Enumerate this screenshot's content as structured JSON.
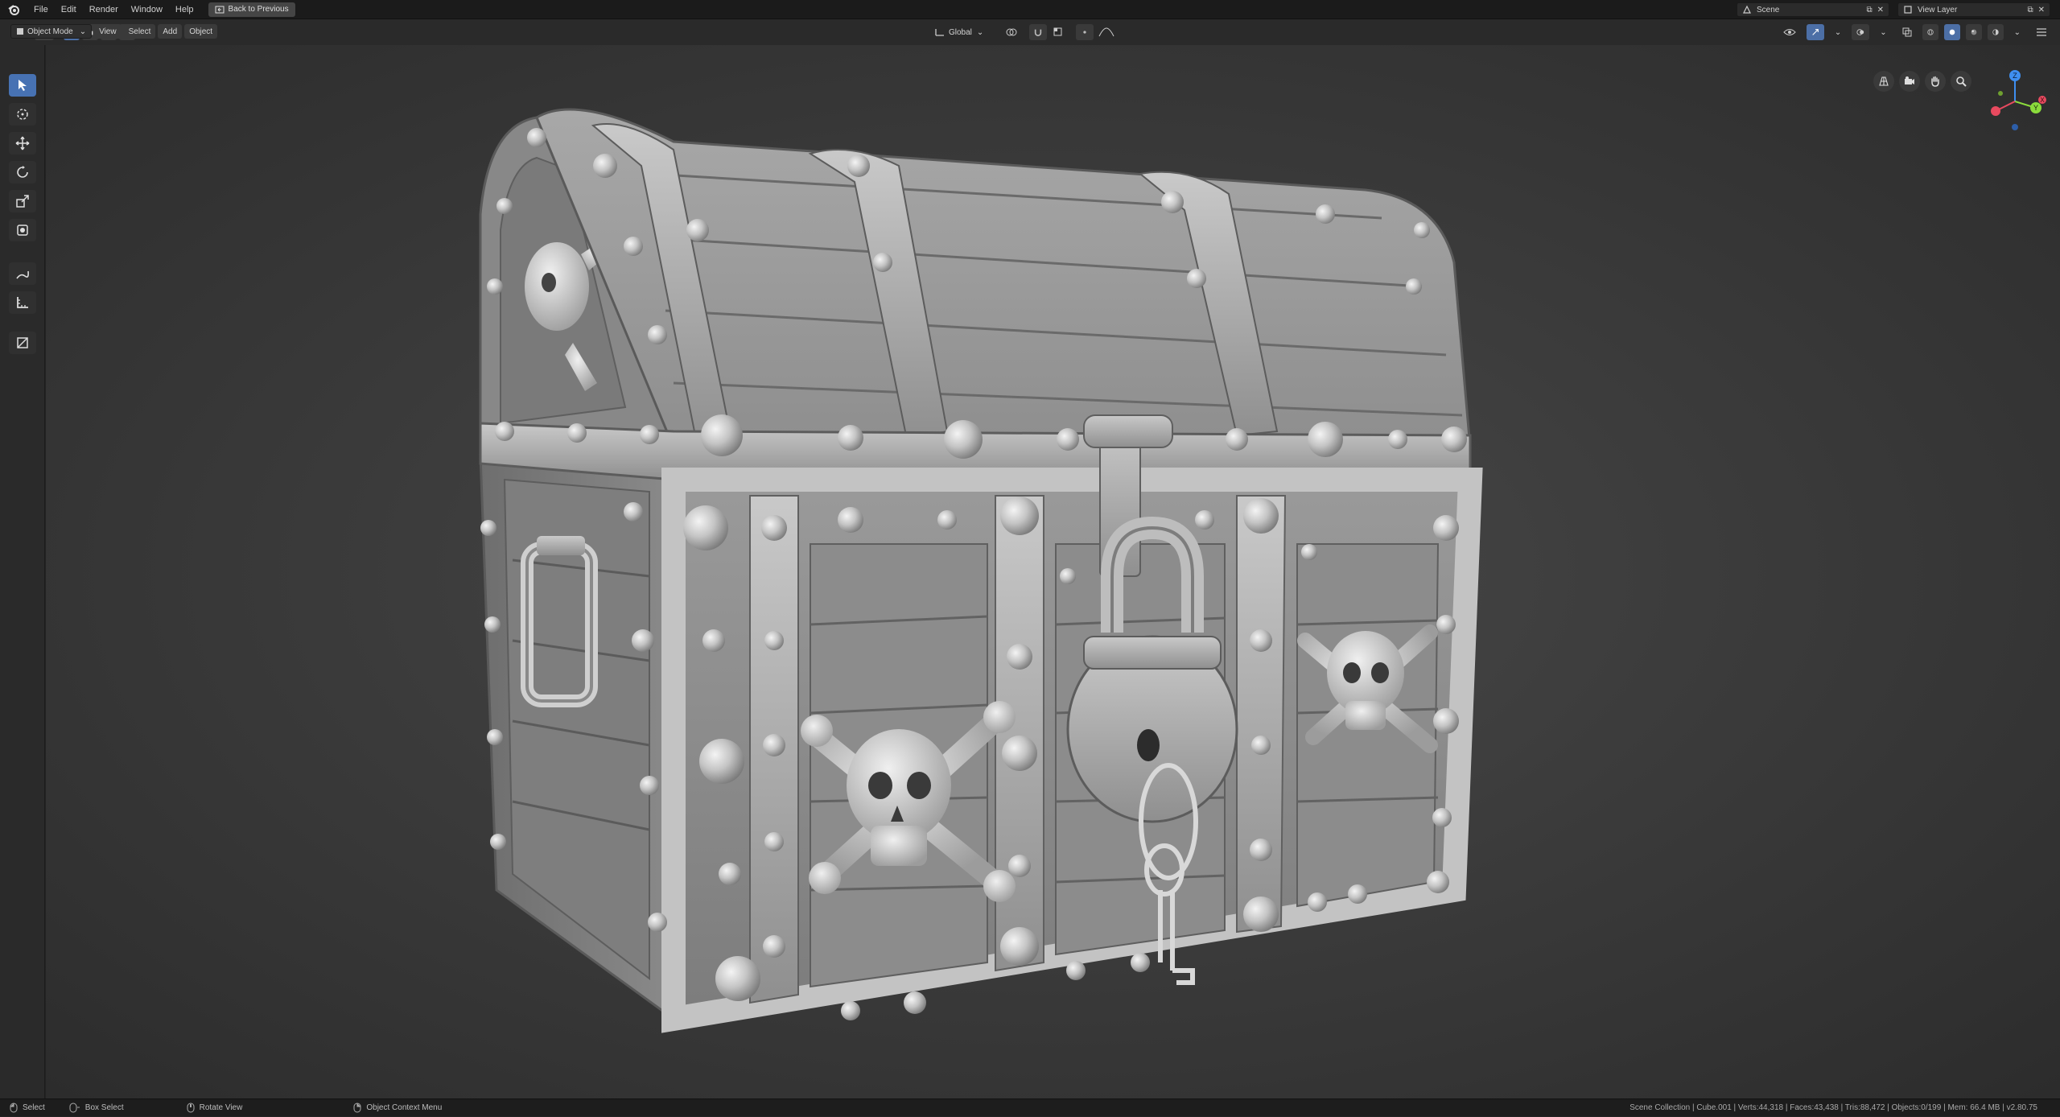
{
  "menu": {
    "items": [
      "File",
      "Edit",
      "Render",
      "Window",
      "Help"
    ],
    "back_button": "Back to Previous"
  },
  "topright": {
    "scene_label": "Scene",
    "view_layer_label": "View Layer"
  },
  "header": {
    "mode": "Object Mode",
    "menus": [
      "View",
      "Select",
      "Add",
      "Object"
    ],
    "transform_orientation": "Global"
  },
  "tools": [
    {
      "name": "select-box-tool",
      "icon": "cursor-arrow-icon",
      "active": true
    },
    {
      "name": "cursor-tool",
      "icon": "crosshair-cursor-icon",
      "active": false
    },
    {
      "name": "move-tool",
      "icon": "move-arrows-icon",
      "active": false
    },
    {
      "name": "rotate-tool",
      "icon": "rotate-icon",
      "active": false
    },
    {
      "name": "scale-tool",
      "icon": "scale-icon",
      "active": false
    },
    {
      "name": "transform-tool",
      "icon": "transform-icon",
      "active": false
    },
    {
      "name": "annotate-tool",
      "icon": "annotate-pen-icon",
      "active": false
    },
    {
      "name": "measure-tool",
      "icon": "ruler-icon",
      "active": false
    },
    {
      "name": "add-cube-tool",
      "icon": "add-cube-icon",
      "active": false
    }
  ],
  "gizmo": {
    "axis_x_color": "#e84a5f",
    "axis_y_color": "#8bdc3c",
    "axis_z_color": "#3f8ff0"
  },
  "status": {
    "select": "Select",
    "box_select": "Box Select",
    "rotate_view": "Rotate View",
    "context_menu": "Object Context Menu",
    "stats": "Scene Collection | Cube.001 | Verts:44,318 | Faces:43,438 | Tris:88,472 | Objects:0/199 | Mem: 66.4 MB | v2.80.75"
  },
  "colors": {
    "accent": "#4772b3",
    "viewport_bg": "#3c3c3c"
  }
}
